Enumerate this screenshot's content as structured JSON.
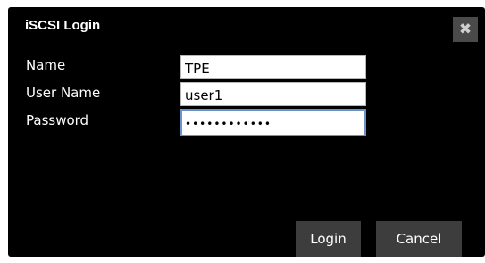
{
  "dialog": {
    "title": "iSCSI Login",
    "close_icon": "close-icon",
    "close_glyph": "✖"
  },
  "form": {
    "name": {
      "label": "Name",
      "value": "TPE"
    },
    "username": {
      "label": "User Name",
      "value": "user1"
    },
    "password": {
      "label": "Password",
      "value": "passwordxyz1"
    }
  },
  "buttons": {
    "login_label": "Login",
    "cancel_label": "Cancel"
  },
  "colors": {
    "dialog_background": "#000000",
    "button_background": "#3d3d3d",
    "focus_border": "#6c93c9"
  }
}
